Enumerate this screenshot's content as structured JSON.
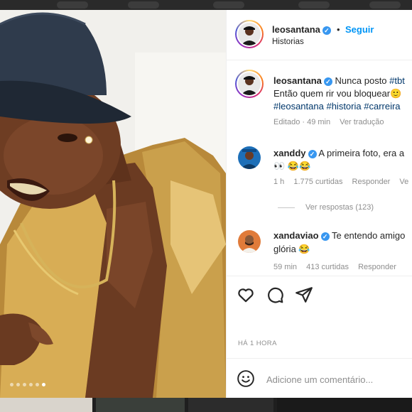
{
  "post": {
    "author": "leosantana",
    "follow_label": "Seguir",
    "location": "Historias",
    "dot": "•",
    "verified_mark": "✓"
  },
  "caption": {
    "username": "leosantana",
    "line1": "Nunca posto ",
    "line1_tag": "#tbt",
    "line2": "Então quem rir vou bloquear",
    "line2_emoji": "🙂",
    "hashtags": [
      "#leosantana",
      "#historia",
      "#carreira"
    ],
    "meta_time": "Editado · 49 min",
    "meta_translate": "Ver tradução"
  },
  "comments": [
    {
      "username": "xanddy",
      "line1": "A primeira foto, era a",
      "line2": "👀 😂😂",
      "time": "1 h",
      "likes": "1.775 curtidas",
      "reply": "Responder",
      "extra": "Ve",
      "view_replies": "Ver respostas (123)"
    },
    {
      "username": "xandaviao",
      "line1": "Te entendo amigo",
      "line2": "glória 😂",
      "time": "59 min",
      "likes": "413 curtidas",
      "reply": "Responder"
    }
  ],
  "timestamp": "HÁ 1 HORA",
  "comment_box": {
    "placeholder": "Adicione um comentário..."
  },
  "icons": {
    "like": "heart-icon",
    "comment": "comment-icon",
    "share": "share-icon",
    "emoji": "emoji-icon"
  },
  "colors": {
    "link_blue": "#0095f6",
    "hashtag": "#00376b",
    "muted": "#8e8e8e",
    "verified": "#3897f0"
  }
}
